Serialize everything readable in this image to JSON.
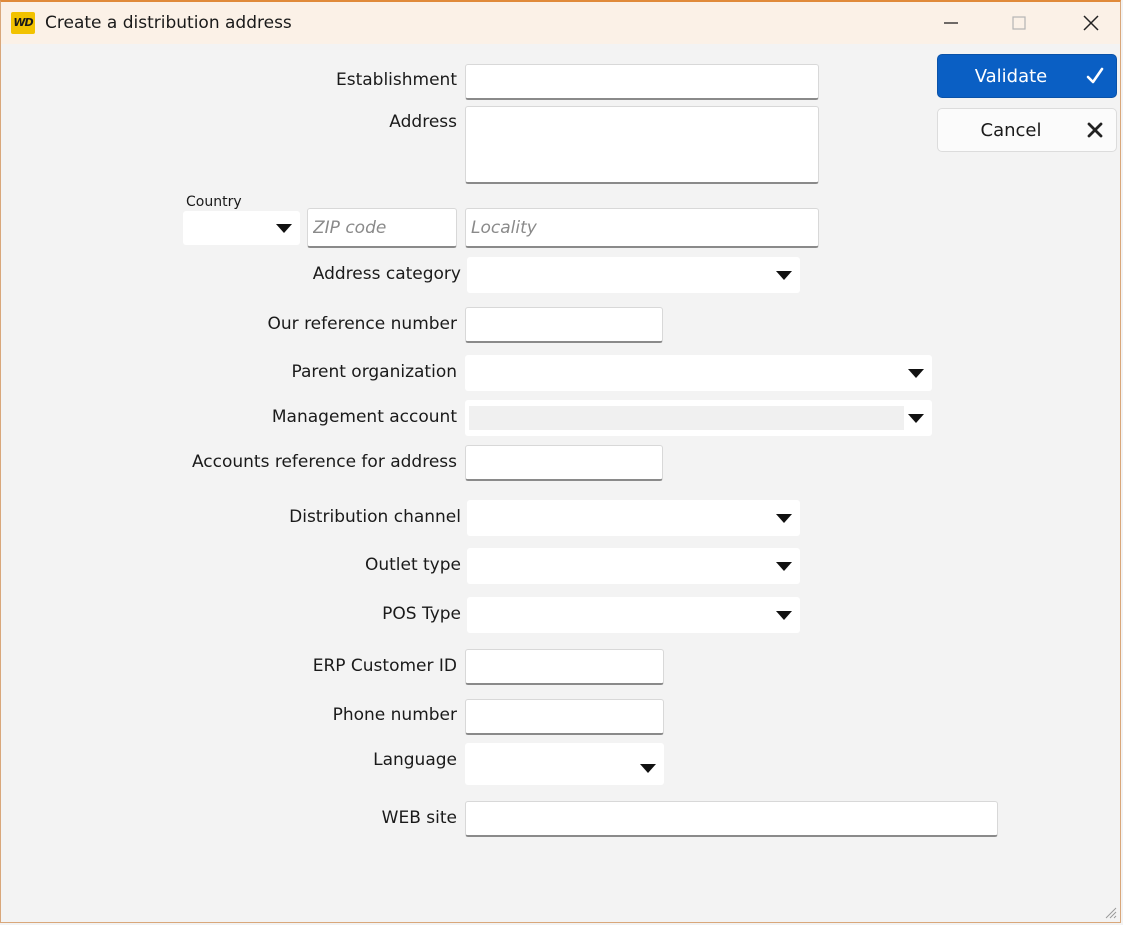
{
  "window": {
    "title": "Create a distribution address",
    "app_icon_text": "WD"
  },
  "actions": {
    "validate_label": "Validate",
    "cancel_label": "Cancel"
  },
  "form": {
    "establishment": {
      "label": "Establishment",
      "value": ""
    },
    "address": {
      "label": "Address",
      "value": ""
    },
    "country": {
      "label": "Country",
      "value": ""
    },
    "zip": {
      "placeholder": "ZIP code",
      "value": ""
    },
    "locality": {
      "placeholder": "Locality",
      "value": ""
    },
    "address_category": {
      "label": "Address category",
      "value": ""
    },
    "our_reference": {
      "label": "Our reference number",
      "value": ""
    },
    "parent_org": {
      "label": "Parent organization",
      "value": ""
    },
    "management_account": {
      "label": "Management account",
      "value": ""
    },
    "accounts_reference": {
      "label": "Accounts reference for address",
      "value": ""
    },
    "distribution_channel": {
      "label": "Distribution channel",
      "value": ""
    },
    "outlet_type": {
      "label": "Outlet type",
      "value": ""
    },
    "pos_type": {
      "label": "POS Type",
      "value": ""
    },
    "erp_customer_id": {
      "label": "ERP Customer ID",
      "value": ""
    },
    "phone": {
      "label": "Phone number",
      "value": ""
    },
    "language": {
      "label": "Language",
      "value": ""
    },
    "website": {
      "label": "WEB site",
      "value": ""
    }
  },
  "colors": {
    "accent": "#0a5fc4",
    "titlebar": "#fbf1e7",
    "window_border": "#e08a3a",
    "app_icon": "#f2c200"
  }
}
